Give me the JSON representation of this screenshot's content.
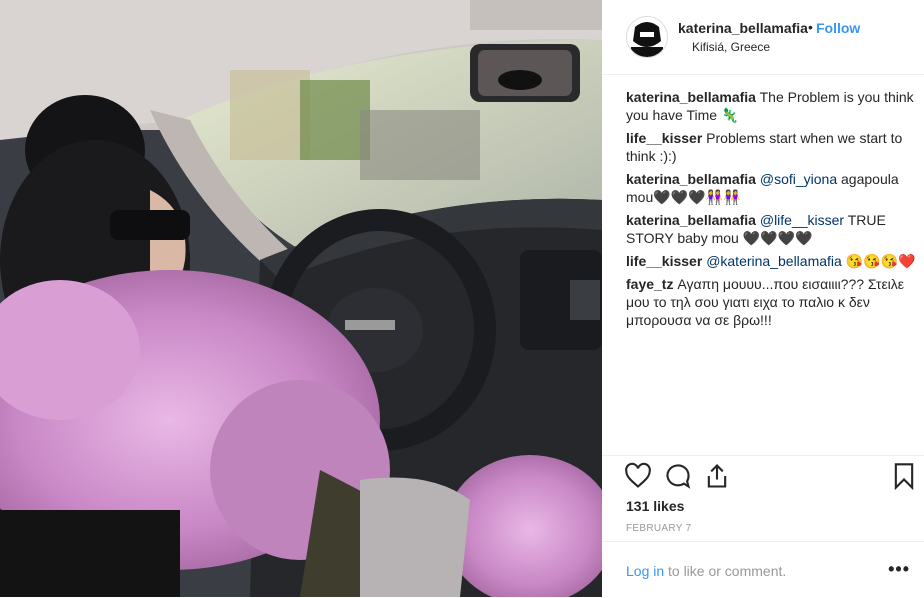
{
  "post": {
    "username": "katerina_bellamafia",
    "dot": "•",
    "follow_label": "Follow",
    "location": "Kifisiá, Greece",
    "photo_description_icon": "car-interior-photo"
  },
  "comments": [
    {
      "user": "katerina_bellamafia",
      "text": " The Problem is you think you have Time 🦎"
    },
    {
      "user": "life__kisser",
      "text": " Problems start when we start to think :):)"
    },
    {
      "user": "katerina_bellamafia",
      "mention": "@sofi_yiona",
      "text": " agapoula mou🖤🖤🖤👭👭"
    },
    {
      "user": "katerina_bellamafia",
      "mention": "@life__kisser",
      "text": " TRUE STORY baby mou 🖤🖤🖤🖤"
    },
    {
      "user": "life__kisser",
      "mention": "@katerina_bellamafia",
      "text": " 😘😘😘❤️"
    },
    {
      "user": "faye_tz",
      "text": " Αγαπη μουυυ...που εισαιιιι??? Στειλε μου το τηλ σου γιατι ειχα το παλιο κ δεν μπορουσα να σε βρω!!!"
    }
  ],
  "stats": {
    "likes": "131 likes",
    "date": "FEBRUARY 7"
  },
  "footer": {
    "login_label": "Log in",
    "rest_text": " to like or comment.",
    "more_label": "•••"
  },
  "colors": {
    "link": "#3897f0",
    "mention": "#003569",
    "fur": "#d9a3d6"
  }
}
